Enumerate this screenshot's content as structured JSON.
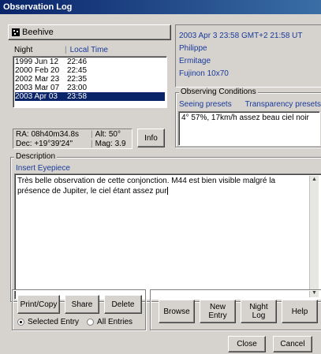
{
  "window": {
    "title": "Observation Log"
  },
  "object": {
    "name": "Beehive",
    "icon": "cluster-icon"
  },
  "observations": {
    "col_night": "Night",
    "col_local_time": "Local Time",
    "rows": [
      {
        "night": "1999 Jun 12",
        "time": "22:46"
      },
      {
        "night": "2000 Feb 20",
        "time": "22:45"
      },
      {
        "night": "2002 Mar 23",
        "time": "22:35"
      },
      {
        "night": "2003 Mar 07",
        "time": "23:00"
      },
      {
        "night": "2003 Apr 03",
        "time": "23:58"
      }
    ],
    "selected_index": 4
  },
  "info_panel": {
    "datetime": "2003 Apr 3 23:58 GMT+2 21:58 UT",
    "observer": "Philippe",
    "site": "Ermitage",
    "instrument": "Fujinon 10x70"
  },
  "conditions": {
    "label": "Observing Conditions",
    "seeing_presets": "Seeing presets",
    "transparency_presets": "Transparency presets",
    "text": "4° 57%, 17km/h assez beau ciel noir"
  },
  "coords": {
    "ra": "RA:  08h40m34.8s",
    "dec": "Dec: +19°39'24\"",
    "alt": "Alt:   50°",
    "mag": "Mag:  3.9",
    "info_button": "Info"
  },
  "description": {
    "label": "Description",
    "insert_eyepiece": "Insert Eyepiece",
    "text": "Très belle observation de cette conjonction. M44 est bien visible malgré la présence de Jupiter, le ciel étant assez pur"
  },
  "actions": {
    "print_copy": "Print/Copy",
    "share": "Share",
    "delete": "Delete",
    "selected_entry": "Selected Entry",
    "all_entries": "All Entries",
    "scope_selected": "selected_entry",
    "browse": "Browse",
    "new_entry": "New Entry",
    "night_log": "Night Log",
    "help": "Help",
    "close": "Close",
    "cancel": "Cancel"
  }
}
